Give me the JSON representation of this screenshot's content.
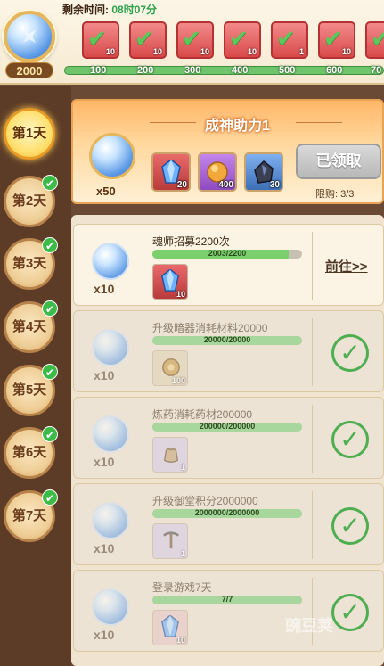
{
  "top": {
    "timer_label": "剩余时间:",
    "timer_value": "08时07分",
    "coin_total": "2000",
    "milestones": [
      {
        "label": "100",
        "count": "10",
        "claimed": true
      },
      {
        "label": "200",
        "count": "10",
        "claimed": true
      },
      {
        "label": "300",
        "count": "10",
        "claimed": true
      },
      {
        "label": "400",
        "count": "10",
        "claimed": true
      },
      {
        "label": "500",
        "count": "1",
        "claimed": true
      },
      {
        "label": "600",
        "count": "10",
        "claimed": true
      },
      {
        "label": "70",
        "count": "",
        "claimed": true
      }
    ]
  },
  "days": [
    {
      "label": "第1天",
      "active": true,
      "done": false
    },
    {
      "label": "第2天",
      "active": false,
      "done": true
    },
    {
      "label": "第3天",
      "active": false,
      "done": true
    },
    {
      "label": "第4天",
      "active": false,
      "done": true
    },
    {
      "label": "第5天",
      "active": false,
      "done": true
    },
    {
      "label": "第6天",
      "active": false,
      "done": true
    },
    {
      "label": "第7天",
      "active": false,
      "done": true
    }
  ],
  "header": {
    "title": "成神助力1",
    "coin_count": "x50",
    "rewards": [
      {
        "amount": "20",
        "color": "#d04848",
        "icon": "crystal-icon"
      },
      {
        "amount": "400",
        "color": "#b065d8",
        "icon": "amber-orb-icon"
      },
      {
        "amount": "30",
        "color": "#5a8fd6",
        "icon": "dark-ore-icon"
      }
    ],
    "button_label": "已领取",
    "limit": "限购: 3/3"
  },
  "tasks": [
    {
      "title": "魂师招募2200次",
      "progress": "2003/2200",
      "fraction": 0.91,
      "mult": "x10",
      "item_amt": "10",
      "item_color": "#d04848",
      "action": "前往>>",
      "done": false
    },
    {
      "title": "升级暗器消耗材料20000",
      "progress": "20000/20000",
      "fraction": 1.0,
      "mult": "x10",
      "item_amt": "100",
      "item_color": "#d6bf94",
      "action": "",
      "done": true
    },
    {
      "title": "炼药消耗药材200000",
      "progress": "200000/200000",
      "fraction": 1.0,
      "mult": "x10",
      "item_amt": "1",
      "item_color": "#c7b7d8",
      "action": "",
      "done": true
    },
    {
      "title": "升级御堂积分2000000",
      "progress": "2000000/2000000",
      "fraction": 1.0,
      "mult": "x10",
      "item_amt": "1",
      "item_color": "#c7b7d8",
      "action": "",
      "done": true
    },
    {
      "title": "登录游戏7天",
      "progress": "7/7",
      "fraction": 1.0,
      "mult": "x10",
      "item_amt": "10",
      "item_color": "#d8b0b0",
      "action": "",
      "done": true
    }
  ],
  "watermark": "豌豆荚"
}
